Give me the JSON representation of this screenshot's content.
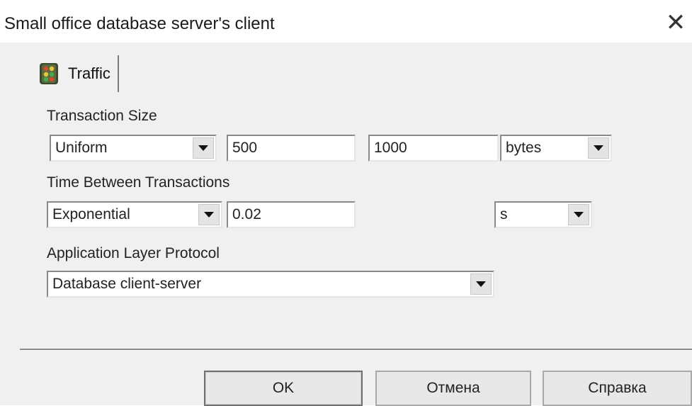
{
  "dialog": {
    "title": "Small office database server's client",
    "close_glyph": "✕"
  },
  "tabs": [
    {
      "label": "Traffic",
      "icon": "traffic-light-icon"
    }
  ],
  "fields": {
    "transaction_size": {
      "label": "Transaction Size",
      "distribution": "Uniform",
      "min": "500",
      "max": "1000",
      "unit": "bytes"
    },
    "time_between": {
      "label": "Time Between Transactions",
      "distribution": "Exponential",
      "mean": "0.02",
      "unit": "s"
    },
    "protocol": {
      "label": "Application Layer Protocol",
      "value": "Database client-server"
    }
  },
  "buttons": {
    "ok": "OK",
    "cancel": "Отмена",
    "help": "Справка"
  }
}
